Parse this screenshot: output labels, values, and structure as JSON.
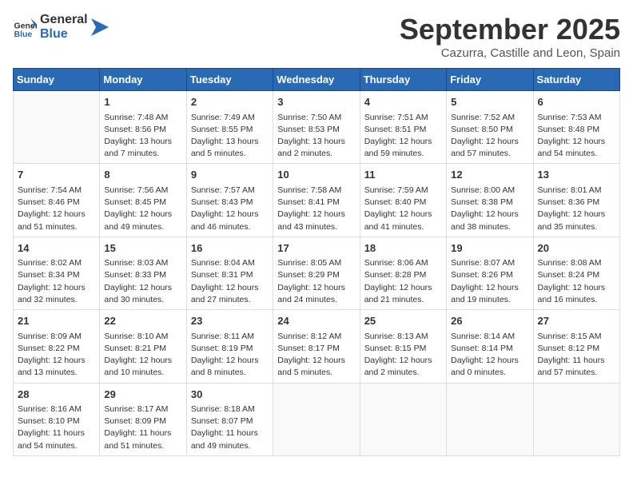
{
  "header": {
    "logo_general": "General",
    "logo_blue": "Blue",
    "month": "September 2025",
    "location": "Cazurra, Castille and Leon, Spain"
  },
  "weekdays": [
    "Sunday",
    "Monday",
    "Tuesday",
    "Wednesday",
    "Thursday",
    "Friday",
    "Saturday"
  ],
  "weeks": [
    [
      {
        "day": null
      },
      {
        "day": "1",
        "sunrise": "7:48 AM",
        "sunset": "8:56 PM",
        "daylight": "13 hours and 7 minutes."
      },
      {
        "day": "2",
        "sunrise": "7:49 AM",
        "sunset": "8:55 PM",
        "daylight": "13 hours and 5 minutes."
      },
      {
        "day": "3",
        "sunrise": "7:50 AM",
        "sunset": "8:53 PM",
        "daylight": "13 hours and 2 minutes."
      },
      {
        "day": "4",
        "sunrise": "7:51 AM",
        "sunset": "8:51 PM",
        "daylight": "12 hours and 59 minutes."
      },
      {
        "day": "5",
        "sunrise": "7:52 AM",
        "sunset": "8:50 PM",
        "daylight": "12 hours and 57 minutes."
      },
      {
        "day": "6",
        "sunrise": "7:53 AM",
        "sunset": "8:48 PM",
        "daylight": "12 hours and 54 minutes."
      }
    ],
    [
      {
        "day": "7",
        "sunrise": "7:54 AM",
        "sunset": "8:46 PM",
        "daylight": "12 hours and 51 minutes."
      },
      {
        "day": "8",
        "sunrise": "7:56 AM",
        "sunset": "8:45 PM",
        "daylight": "12 hours and 49 minutes."
      },
      {
        "day": "9",
        "sunrise": "7:57 AM",
        "sunset": "8:43 PM",
        "daylight": "12 hours and 46 minutes."
      },
      {
        "day": "10",
        "sunrise": "7:58 AM",
        "sunset": "8:41 PM",
        "daylight": "12 hours and 43 minutes."
      },
      {
        "day": "11",
        "sunrise": "7:59 AM",
        "sunset": "8:40 PM",
        "daylight": "12 hours and 41 minutes."
      },
      {
        "day": "12",
        "sunrise": "8:00 AM",
        "sunset": "8:38 PM",
        "daylight": "12 hours and 38 minutes."
      },
      {
        "day": "13",
        "sunrise": "8:01 AM",
        "sunset": "8:36 PM",
        "daylight": "12 hours and 35 minutes."
      }
    ],
    [
      {
        "day": "14",
        "sunrise": "8:02 AM",
        "sunset": "8:34 PM",
        "daylight": "12 hours and 32 minutes."
      },
      {
        "day": "15",
        "sunrise": "8:03 AM",
        "sunset": "8:33 PM",
        "daylight": "12 hours and 30 minutes."
      },
      {
        "day": "16",
        "sunrise": "8:04 AM",
        "sunset": "8:31 PM",
        "daylight": "12 hours and 27 minutes."
      },
      {
        "day": "17",
        "sunrise": "8:05 AM",
        "sunset": "8:29 PM",
        "daylight": "12 hours and 24 minutes."
      },
      {
        "day": "18",
        "sunrise": "8:06 AM",
        "sunset": "8:28 PM",
        "daylight": "12 hours and 21 minutes."
      },
      {
        "day": "19",
        "sunrise": "8:07 AM",
        "sunset": "8:26 PM",
        "daylight": "12 hours and 19 minutes."
      },
      {
        "day": "20",
        "sunrise": "8:08 AM",
        "sunset": "8:24 PM",
        "daylight": "12 hours and 16 minutes."
      }
    ],
    [
      {
        "day": "21",
        "sunrise": "8:09 AM",
        "sunset": "8:22 PM",
        "daylight": "12 hours and 13 minutes."
      },
      {
        "day": "22",
        "sunrise": "8:10 AM",
        "sunset": "8:21 PM",
        "daylight": "12 hours and 10 minutes."
      },
      {
        "day": "23",
        "sunrise": "8:11 AM",
        "sunset": "8:19 PM",
        "daylight": "12 hours and 8 minutes."
      },
      {
        "day": "24",
        "sunrise": "8:12 AM",
        "sunset": "8:17 PM",
        "daylight": "12 hours and 5 minutes."
      },
      {
        "day": "25",
        "sunrise": "8:13 AM",
        "sunset": "8:15 PM",
        "daylight": "12 hours and 2 minutes."
      },
      {
        "day": "26",
        "sunrise": "8:14 AM",
        "sunset": "8:14 PM",
        "daylight": "12 hours and 0 minutes."
      },
      {
        "day": "27",
        "sunrise": "8:15 AM",
        "sunset": "8:12 PM",
        "daylight": "11 hours and 57 minutes."
      }
    ],
    [
      {
        "day": "28",
        "sunrise": "8:16 AM",
        "sunset": "8:10 PM",
        "daylight": "11 hours and 54 minutes."
      },
      {
        "day": "29",
        "sunrise": "8:17 AM",
        "sunset": "8:09 PM",
        "daylight": "11 hours and 51 minutes."
      },
      {
        "day": "30",
        "sunrise": "8:18 AM",
        "sunset": "8:07 PM",
        "daylight": "11 hours and 49 minutes."
      },
      {
        "day": null
      },
      {
        "day": null
      },
      {
        "day": null
      },
      {
        "day": null
      }
    ]
  ]
}
